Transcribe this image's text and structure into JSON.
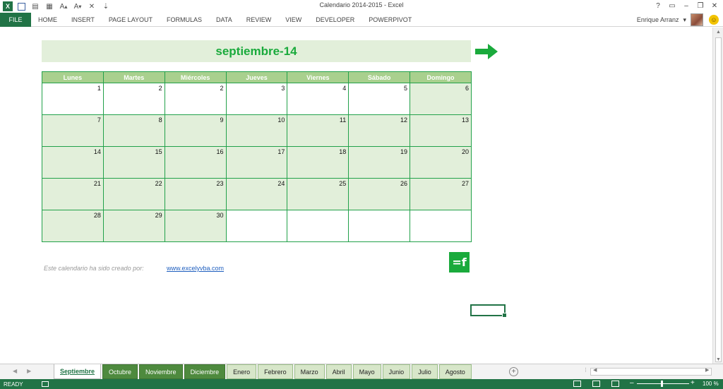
{
  "window": {
    "title": "Calendario 2014-2015 - Excel",
    "controls": [
      "?",
      "▭",
      "–",
      "❐",
      "✕"
    ]
  },
  "qat": {
    "app_letter": "X",
    "icons": [
      "excel-icon",
      "save-icon",
      "print-preview-icon",
      "form-icon",
      "font-up-icon",
      "font-down-icon",
      "clear-icon",
      "customize-icon"
    ]
  },
  "ribbon": {
    "file": "FILE",
    "tabs": [
      "HOME",
      "INSERT",
      "PAGE LAYOUT",
      "FORMULAS",
      "DATA",
      "REVIEW",
      "VIEW",
      "DEVELOPER",
      "POWERPIVOT"
    ],
    "user": "Enrique Arranz"
  },
  "calendar": {
    "month": "septiembre-14",
    "days": [
      "Lunes",
      "Martes",
      "Miércoles",
      "Jueves",
      "Viernes",
      "Sábado",
      "Domingo"
    ],
    "weeks": [
      [
        "1",
        "2",
        "2",
        "3",
        "4",
        "5",
        "6"
      ],
      [
        "7",
        "8",
        "9",
        "10",
        "11",
        "12",
        "13"
      ],
      [
        "14",
        "15",
        "16",
        "17",
        "18",
        "19",
        "20"
      ],
      [
        "21",
        "22",
        "23",
        "24",
        "25",
        "26",
        "27"
      ],
      [
        "28",
        "29",
        "30",
        "",
        "",
        "",
        ""
      ]
    ]
  },
  "credit": {
    "text": "Este calendario ha sido creado por:",
    "link": "www.excelyvba.com",
    "logo": "=f"
  },
  "sheets": {
    "active": "Septiembre",
    "dark": [
      "Octubre",
      "Noviembre",
      "Diciembre"
    ],
    "light": [
      "Enero",
      "Febrero",
      "Marzo",
      "Abril",
      "Mayo",
      "Junio",
      "Julio",
      "Agosto"
    ],
    "add": "+"
  },
  "status": {
    "ready": "READY",
    "zoom": "100 %",
    "zoom_minus": "–",
    "zoom_plus": "+"
  }
}
